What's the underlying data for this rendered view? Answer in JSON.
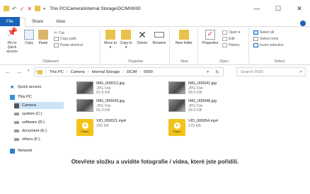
{
  "window": {
    "title": "This PC\\Camera\\Internal Storage\\DCIM\\0000",
    "controls": {
      "minimize": "—",
      "maximize": "☐",
      "close": "✕"
    }
  },
  "tabs": [
    "File",
    "Home",
    "Share",
    "View"
  ],
  "ribbon": {
    "clipboard": {
      "pin": "Pin to Quick access",
      "copy": "Copy",
      "paste": "Paste",
      "cut": "Cut",
      "copy_path": "Copy path",
      "paste_shortcut": "Paste shortcut",
      "label": "Clipboard"
    },
    "organise": {
      "move_to": "Move to ▾",
      "copy_to": "Copy to ▾",
      "delete": "Delete",
      "rename": "Rename",
      "label": "Organise"
    },
    "new": {
      "new_folder": "New folder",
      "label": "New"
    },
    "open": {
      "properties": "Properties",
      "open": "Open ▾",
      "edit": "Edit",
      "history": "History",
      "label": "Open"
    },
    "select": {
      "select_all": "Select all",
      "select_none": "Select none",
      "invert": "Invert selection",
      "label": "Select"
    }
  },
  "address": {
    "crumbs": [
      "This PC",
      "Camera",
      "Internal Storage",
      "DCIM",
      "0000"
    ],
    "search_placeholder": "Search 0000"
  },
  "nav_pane": {
    "quick_access": "Quick access",
    "this_pc": "This PC",
    "camera": "Camera",
    "system": "system (C:)",
    "software": "software (D:)",
    "document": "document (E:)",
    "others": "others (F:)",
    "network": "Network"
  },
  "files": [
    {
      "name": "IMG_000012.jpg",
      "type": "JPG File",
      "size": "62.8 KB"
    },
    {
      "name": "IMG_000041.jpg",
      "type": "JPG File",
      "size": "58.6 KB"
    },
    {
      "name": "IMG_000043.jpg",
      "type": "JPG File",
      "size": "55.3 KB"
    },
    {
      "name": "IMG_000048.jpg",
      "type": "JPG File",
      "size": "58.5 KB"
    },
    {
      "name": "VID_000021.mp4",
      "type": "",
      "size": "335 KB",
      "badge": "Player"
    },
    {
      "name": "VID_000054.mp4",
      "type": "",
      "size": "279 KB",
      "badge": "Player"
    }
  ],
  "caption": "Otevřete složku a uvidíte fotografie / videa, které jste pořídili.",
  "colors": {
    "file_tab": "#1a62b8",
    "folder": "#e9c24b",
    "player": "#f3c31a",
    "selection": "#cde4f7"
  }
}
